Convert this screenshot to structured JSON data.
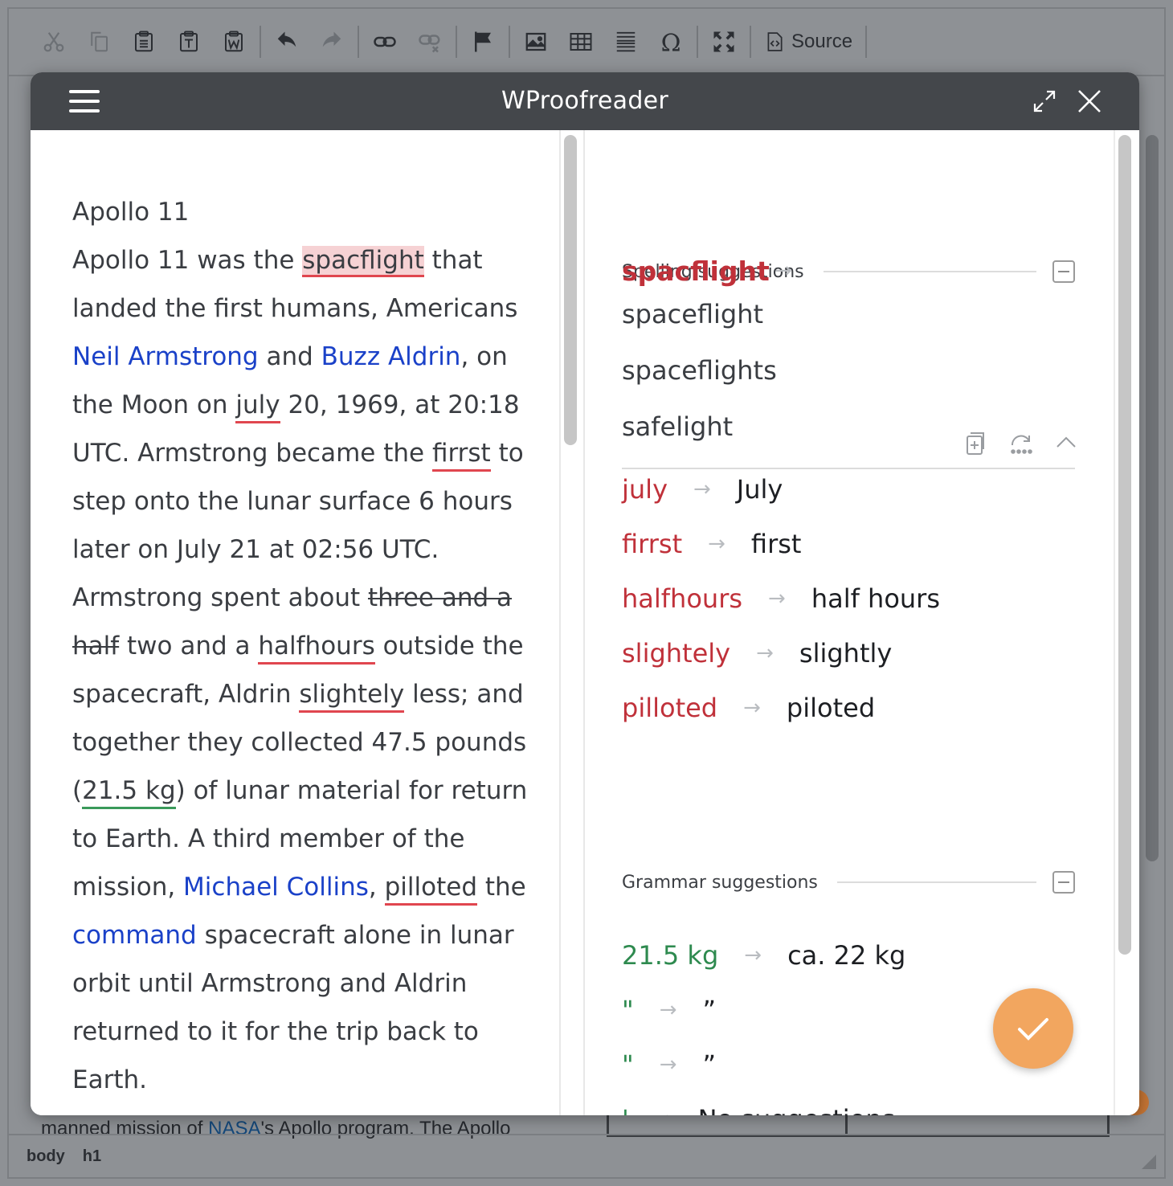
{
  "toolbar": {
    "source_label": "Source"
  },
  "editor": {
    "background_line_before": "manned mission of ",
    "background_link": "NASA",
    "background_line_after": "'s Apollo program. The Apollo",
    "status": [
      "body",
      "h1"
    ]
  },
  "dialog": {
    "title": "WProofreader"
  },
  "document": {
    "title": "Apollo 11",
    "t1": "Apollo 11 was the ",
    "w_spacflight": "spacflight",
    "t2": " that landed the first humans, Americans ",
    "link_neil": "Neil Armstrong",
    "t3": " and ",
    "link_buzz": "Buzz Aldrin",
    "t4": ", on the Moon on ",
    "w_july": "july",
    "t5": " 20, 1969, at 20:18 UTC. Armstrong became the ",
    "w_firrst": "firrst",
    "t6": " to step onto the lunar surface 6 hours later on July 21 at 02:56 UTC. Armstrong spent about ",
    "strike": "three and a half",
    "t7": " two and a ",
    "w_halfhours": "halfhours",
    "t8": " outside the spacecraft, Aldrin ",
    "w_slightely": "slightely",
    "t9": " less; and together they collected 47.5 pounds (",
    "g_kg": "21.5 kg",
    "t10": ") of lunar material for return to Earth. A third member of the mission, ",
    "link_collins": "Michael Collins",
    "t11": ", ",
    "w_pilloted": "pilloted",
    "t12": " the ",
    "link_command": "command",
    "t13": " spacecraft alone in lunar orbit until Armstrong and Aldrin returned to it for the trip back to Earth."
  },
  "spelling": {
    "header": "Spelling suggestions",
    "active_word": "spacflight",
    "alternatives": [
      "spaceflight",
      "spaceflights",
      "safelight"
    ],
    "items": [
      {
        "bad": "july",
        "good": "July"
      },
      {
        "bad": "firrst",
        "good": "first"
      },
      {
        "bad": "halfhours",
        "good": "half hours"
      },
      {
        "bad": "slightely",
        "good": "slightly"
      },
      {
        "bad": "pilloted",
        "good": "piloted"
      }
    ]
  },
  "grammar": {
    "header": "Grammar suggestions",
    "items": [
      {
        "bad": "21.5 kg",
        "good": "ca. 22 kg"
      },
      {
        "bad": "\"",
        "good": "”"
      },
      {
        "bad": "\"",
        "good": "”"
      },
      {
        "bad": "'",
        "good": "No suggestions"
      }
    ]
  },
  "colors": {
    "spelling_error": "#c0313a",
    "grammar_error": "#2e8a4f",
    "link": "#1a41c8",
    "header_bg": "#44474b",
    "accept_button": "#f2a65f"
  }
}
